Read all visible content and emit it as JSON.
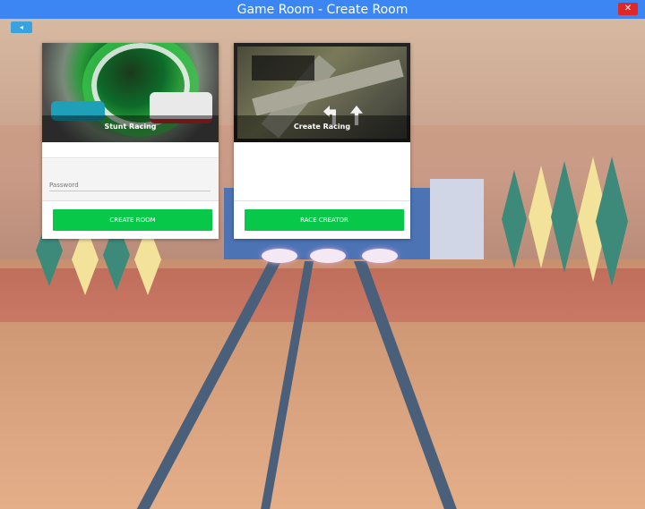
{
  "window": {
    "title": "Game Room - Create Room",
    "close_label": "✕",
    "back_label": "◂"
  },
  "cards": [
    {
      "caption": "Stunt Racing",
      "password_placeholder": "Password",
      "button_label": "CREATE ROOM"
    },
    {
      "caption": "Create Racing",
      "button_label": "RACE CREATOR"
    }
  ],
  "colors": {
    "titlebar": "#3b86f2",
    "close": "#e02626",
    "back": "#3aa2e0",
    "action_button": "#08c849"
  }
}
